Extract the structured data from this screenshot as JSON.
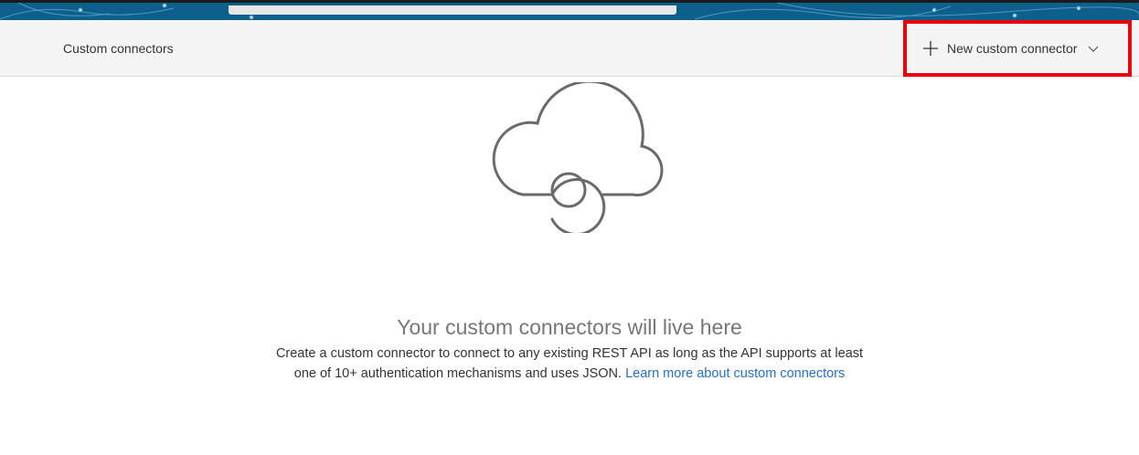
{
  "header": {
    "title": "Custom connectors",
    "new_button_label": "New custom connector",
    "plus_icon": "plus-icon",
    "chevron_icon": "chevron-down-icon"
  },
  "empty_state": {
    "icon": "cloud-connector-icon",
    "title": "Your custom connectors will live here",
    "description_line1": "Create a custom connector to connect to any existing REST API as long as the API supports at least",
    "description_line2": "one of 10+ authentication mechanisms and uses JSON.",
    "link_label": "Learn more about custom connectors"
  },
  "colors": {
    "highlight": "#e8000b",
    "link": "#1f6fd0",
    "banner": "#0d5f8c"
  }
}
